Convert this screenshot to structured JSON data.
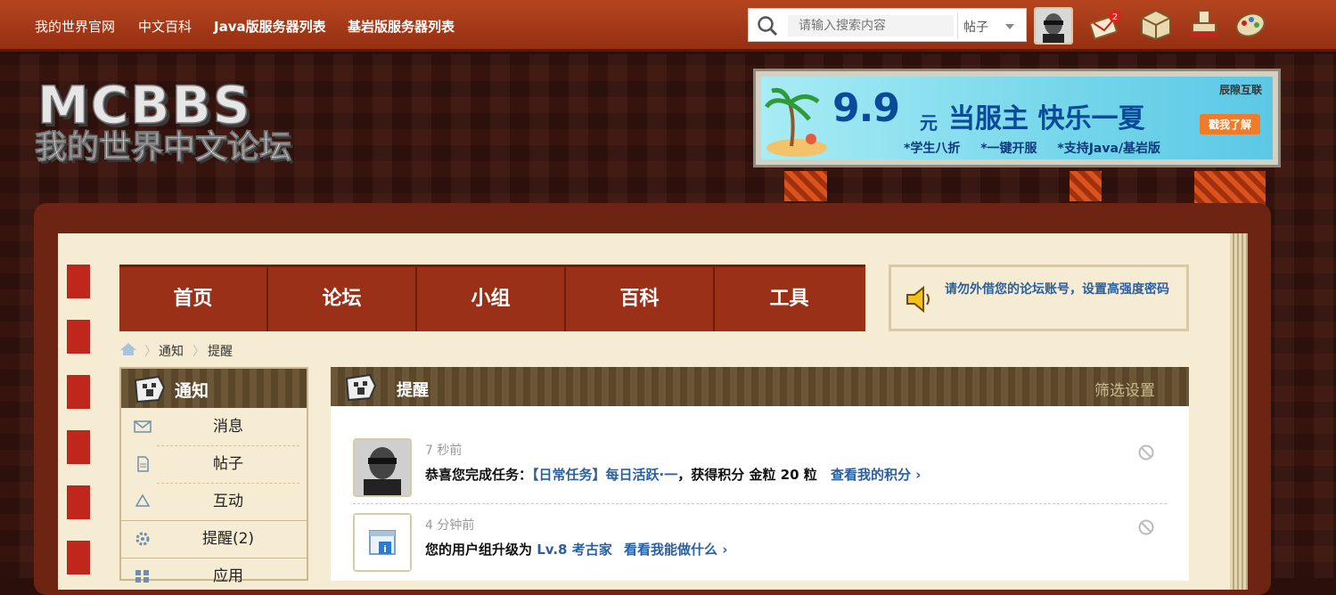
{
  "topbar": {
    "links": [
      "我的世界官网",
      "中文百科",
      "Java版服务器列表",
      "基岩版服务器列表"
    ],
    "search_placeholder": "请输入搜索内容",
    "search_type": "帖子",
    "notif_badge": "2"
  },
  "banner": {
    "price": "9.9",
    "unit": "元",
    "slogan": "当服主 快乐一夏",
    "features": "*学生八折 *一键开服 *支持Java/基岩版",
    "brand": "辰隙互联",
    "button": "戳我了解"
  },
  "nav": {
    "items": [
      "首页",
      "论坛",
      "小组",
      "百科",
      "工具"
    ],
    "notice": "请勿外借您的论坛账号，设置高强度密码"
  },
  "breadcrumb": [
    "通知",
    "提醒"
  ],
  "sidebar": {
    "title": "通知",
    "items": [
      "消息",
      "帖子",
      "互动",
      "提醒(2)",
      "应用"
    ]
  },
  "panel": {
    "title": "提醒",
    "filter": "筛选设置",
    "notifications": [
      {
        "time": "7 秒前",
        "prefix": "恭喜您完成任务：",
        "task": "【日常任务】每日活跃·一",
        "middle": "，获得积分 金粒 20 粒",
        "link": "查看我的积分 ›"
      },
      {
        "time": "4 分钟前",
        "prefix": "您的用户组升级为",
        "task": "Lv.8 考古家",
        "middle": "",
        "link": "看看我能做什么 ›"
      }
    ]
  },
  "colors": {
    "topbar": "#b5451f",
    "nav": "#9b3019",
    "link": "#2a5fa0",
    "paper": "#f6ecd3"
  }
}
